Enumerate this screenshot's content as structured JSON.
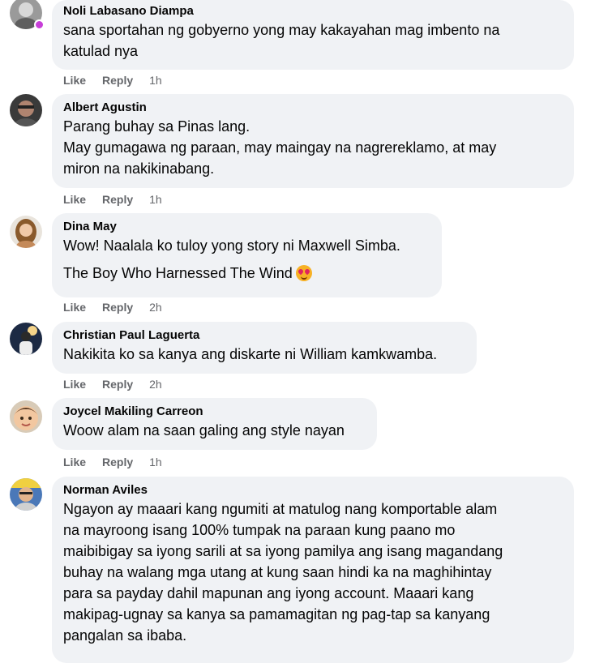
{
  "actions": {
    "like": "Like",
    "reply": "Reply"
  },
  "comments": [
    {
      "author": "Noli Labasano Diampa",
      "lines": [
        "sana sportahan ng gobyerno yong may kakayahan mag imbento na\nkatulad nya"
      ],
      "time": "1h"
    },
    {
      "author": "Albert Agustin",
      "lines": [
        "Parang buhay sa Pinas lang.\nMay gumagawa ng paraan, may maingay na nagrereklamo, at may\nmiron na nakikinabang."
      ],
      "time": "1h"
    },
    {
      "author": "Dina May",
      "lines": [
        "Wow! Naalala ko tuloy yong story ni Maxwell Simba.",
        "The Boy Who Harnessed The Wind"
      ],
      "emoji": "heart-eyes-emoji",
      "time": "2h"
    },
    {
      "author": "Christian Paul Laguerta",
      "lines": [
        "Nakikita ko sa kanya ang diskarte ni William kamkwamba."
      ],
      "time": "2h"
    },
    {
      "author": "Joycel Makiling Carreon",
      "lines": [
        "Woow alam na saan galing ang style nayan"
      ],
      "time": "1h"
    },
    {
      "author": "Norman Aviles",
      "lines": [
        "Ngayon ay maaari kang ngumiti at matulog nang komportable alam\nna mayroong isang 100% tumpak na paraan kung paano mo\nmaibibigay sa iyong sarili at sa iyong pamilya ang isang magandang\nbuhay na walang mga utang at kung saan hindi ka na maghihintay\npara sa payday dahil mapunan ang iyong account. Maaari kang\nmakipag-ugnay sa kanya sa pamamagitan ng pag-tap sa kanyang\npangalan sa ibaba."
      ]
    }
  ]
}
